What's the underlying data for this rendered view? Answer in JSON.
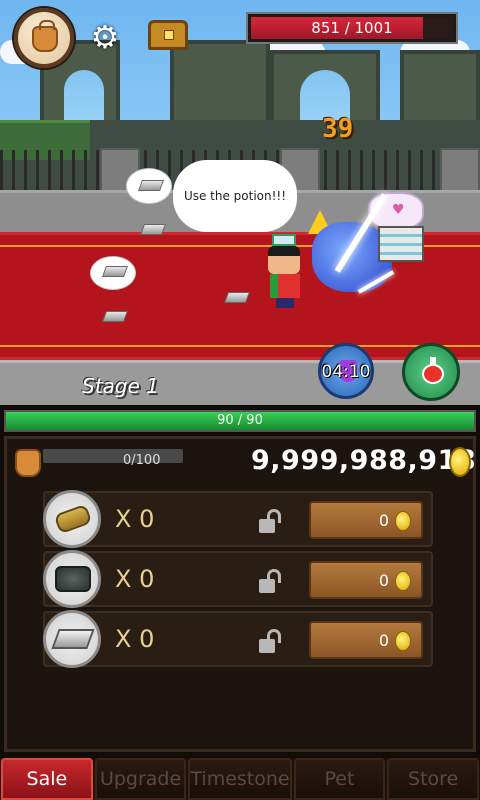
{
  "hud": {
    "boss_hp_text": "851 / 1001",
    "boss_hp_fraction": 0.85
  },
  "battle": {
    "damage_number": "39",
    "speech": "Use the potion!!!",
    "stage_label": "Stage 1",
    "potion_timer": "04:10"
  },
  "player": {
    "hp_text": "90 / 90",
    "hp_fraction": 1.0
  },
  "inventory": {
    "capacity_text": "0/100",
    "gold": "9,999,988,918",
    "items": [
      {
        "icon": "wood-log-icon",
        "count": "X 0",
        "sell_value": "0"
      },
      {
        "icon": "coal-ore-icon",
        "count": "X 0",
        "sell_value": "0"
      },
      {
        "icon": "iron-ingot-icon",
        "count": "X 0",
        "sell_value": "0"
      }
    ]
  },
  "tabs": [
    {
      "label": "Sale",
      "active": true
    },
    {
      "label": "Upgrade",
      "active": false
    },
    {
      "label": "Timestone",
      "active": false
    },
    {
      "label": "Pet",
      "active": false
    },
    {
      "label": "Store",
      "active": false
    }
  ],
  "colors": {
    "boss_hp": "#d8263a",
    "player_hp": "#3bd05a",
    "active_tab": "#c8282c",
    "carpet": "#b4141b"
  }
}
